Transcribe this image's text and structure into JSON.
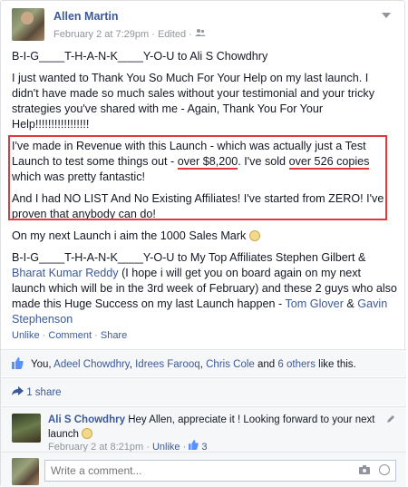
{
  "post": {
    "author": "Allen Martin",
    "date": "February 2 at 7:29pm",
    "dot1": "·",
    "edited": "Edited",
    "dot2": "·",
    "line1_a": "B-I-G____T-H-A-N-K____Y-O-U to Ali S Chowdhry",
    "para1": "I just wanted to Thank You So Much For Your Help on my last launch. I didn't have made so much sales without your testimonial and your tricky strategies you've shared with me - Again, Thank You For Your Help!!!!!!!!!!!!!!!!!",
    "para2_a": "I've made in Revenue with this Launch - which was actually just a Test Launch to test some things out - ",
    "para2_b": "over $8,200",
    "para2_c": ". I've sold ",
    "para2_d": "over 526 copies",
    "para2_e": " which was pretty fantastic!",
    "para3": "And I had NO LIST And No Existing Affiliates! I've started from ZERO! I've proven that anybody can do!",
    "para4": "On my next Launch i aim the 1000 Sales Mark",
    "para5_a": "B-I-G____T-H-A-N-K____Y-O-U to My Top Affiliates Stephen Gilbert & ",
    "para5_link1": "Bharat Kumar Reddy",
    "para5_b": " (I hope i will get you on board again on my next launch which will be in the 3rd week of February) and these 2 guys who also made this Huge Success on my last Launch happen - ",
    "para5_link2": "Tom Glover",
    "para5_c": " & ",
    "para5_link3": "Gavin Stephenson"
  },
  "actions": {
    "unlike": "Unlike",
    "sep1": "·",
    "comment": "Comment",
    "sep2": "·",
    "share": "Share"
  },
  "likes": {
    "you": "You,",
    "p1": "Adeel Chowdhry",
    "sep1": ",",
    "p2": "Idrees Farooq",
    "sep2": ",",
    "p3": "Chris Cole",
    "and": "and",
    "others": "6 others",
    "tail": "like this."
  },
  "shares": {
    "label": "1 share"
  },
  "comment": {
    "name": "Ali S Chowdhry",
    "text": "Hey Allen, appreciate it ! Looking forward to your next launch",
    "date": "February 2 at 8:21pm",
    "sep1": "·",
    "unlike": "Unlike",
    "sep2": "·",
    "like_count": "3"
  },
  "write": {
    "placeholder": "Write a comment..."
  },
  "colors": {
    "link": "#3b5998",
    "highlight_border": "#e0393e",
    "muted": "#90949c"
  }
}
